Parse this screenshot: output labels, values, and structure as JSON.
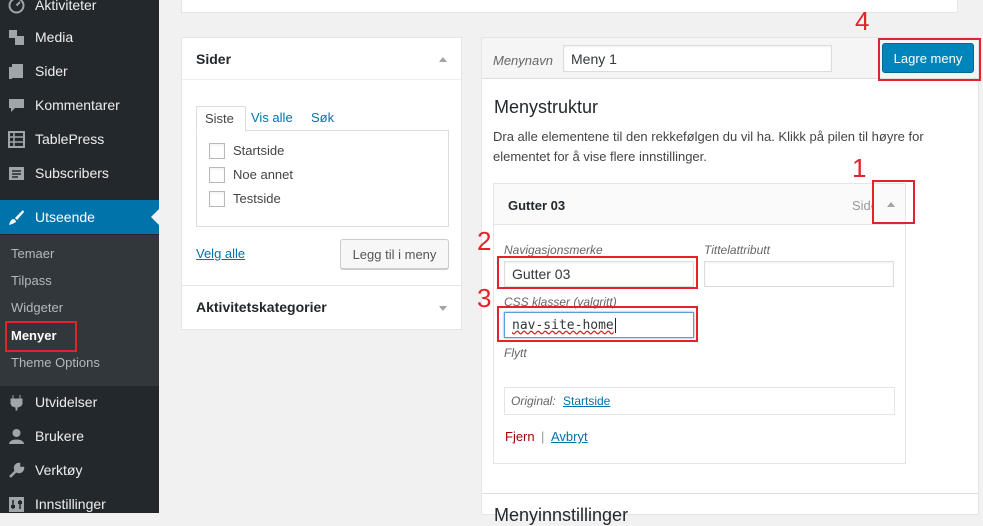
{
  "sidebar": {
    "items": [
      {
        "label": "Aktiviteter",
        "icon": "dashboard-icon"
      },
      {
        "label": "Media",
        "icon": "media-icon"
      },
      {
        "label": "Sider",
        "icon": "pages-icon"
      },
      {
        "label": "Kommentarer",
        "icon": "comments-icon"
      },
      {
        "label": "TablePress",
        "icon": "table-icon"
      },
      {
        "label": "Subscribers",
        "icon": "subscribers-icon"
      },
      {
        "label": "Utseende",
        "icon": "paintbrush-icon"
      },
      {
        "label": "Utvidelser",
        "icon": "plugins-icon"
      },
      {
        "label": "Brukere",
        "icon": "users-icon"
      },
      {
        "label": "Verktøy",
        "icon": "tools-icon"
      },
      {
        "label": "Innstillinger",
        "icon": "settings-icon"
      }
    ],
    "submenu": [
      "Temaer",
      "Tilpass",
      "Widgeter",
      "Menyer",
      "Theme Options"
    ],
    "active_item": "Utseende",
    "current_submenu": "Menyer"
  },
  "pages_box": {
    "title": "Sider",
    "tabs": [
      "Siste",
      "Vis alle",
      "Søk"
    ],
    "pages": [
      "Startside",
      "Noe annet",
      "Testside"
    ],
    "select_all": "Velg alle",
    "add_button": "Legg til i meny"
  },
  "activity_box": {
    "title": "Aktivitetskategorier"
  },
  "menu_editor": {
    "name_label": "Menynavn",
    "name_value": "Meny 1",
    "save_button": "Lagre meny",
    "structure_title": "Menystruktur",
    "instructions": "Dra alle elementene til den rekkefølgen du vil ha. Klikk på pilen til høyre for elementet for å vise flere innstillinger.",
    "item": {
      "title": "Gutter 03",
      "type": "Side",
      "nav_label": "Navigasjonsmerke",
      "nav_value": "Gutter 03",
      "title_attr_label": "Tittelattributt",
      "title_attr_value": "",
      "css_label": "CSS klasser (valgritt)",
      "css_value": "nav-site-home",
      "move_label": "Flytt",
      "original_label": "Original:",
      "original_link": "Startside",
      "remove": "Fjern",
      "separator": "|",
      "cancel": "Avbryt"
    },
    "settings_title_partial": "Menyinnstillinger"
  },
  "annotations": [
    "1",
    "2",
    "3",
    "4"
  ],
  "colors": {
    "sidebar": "#23282d",
    "submenu": "#32373c",
    "accent": "#0073aa",
    "annotation": "#e2242a",
    "button": "#0085ba"
  }
}
